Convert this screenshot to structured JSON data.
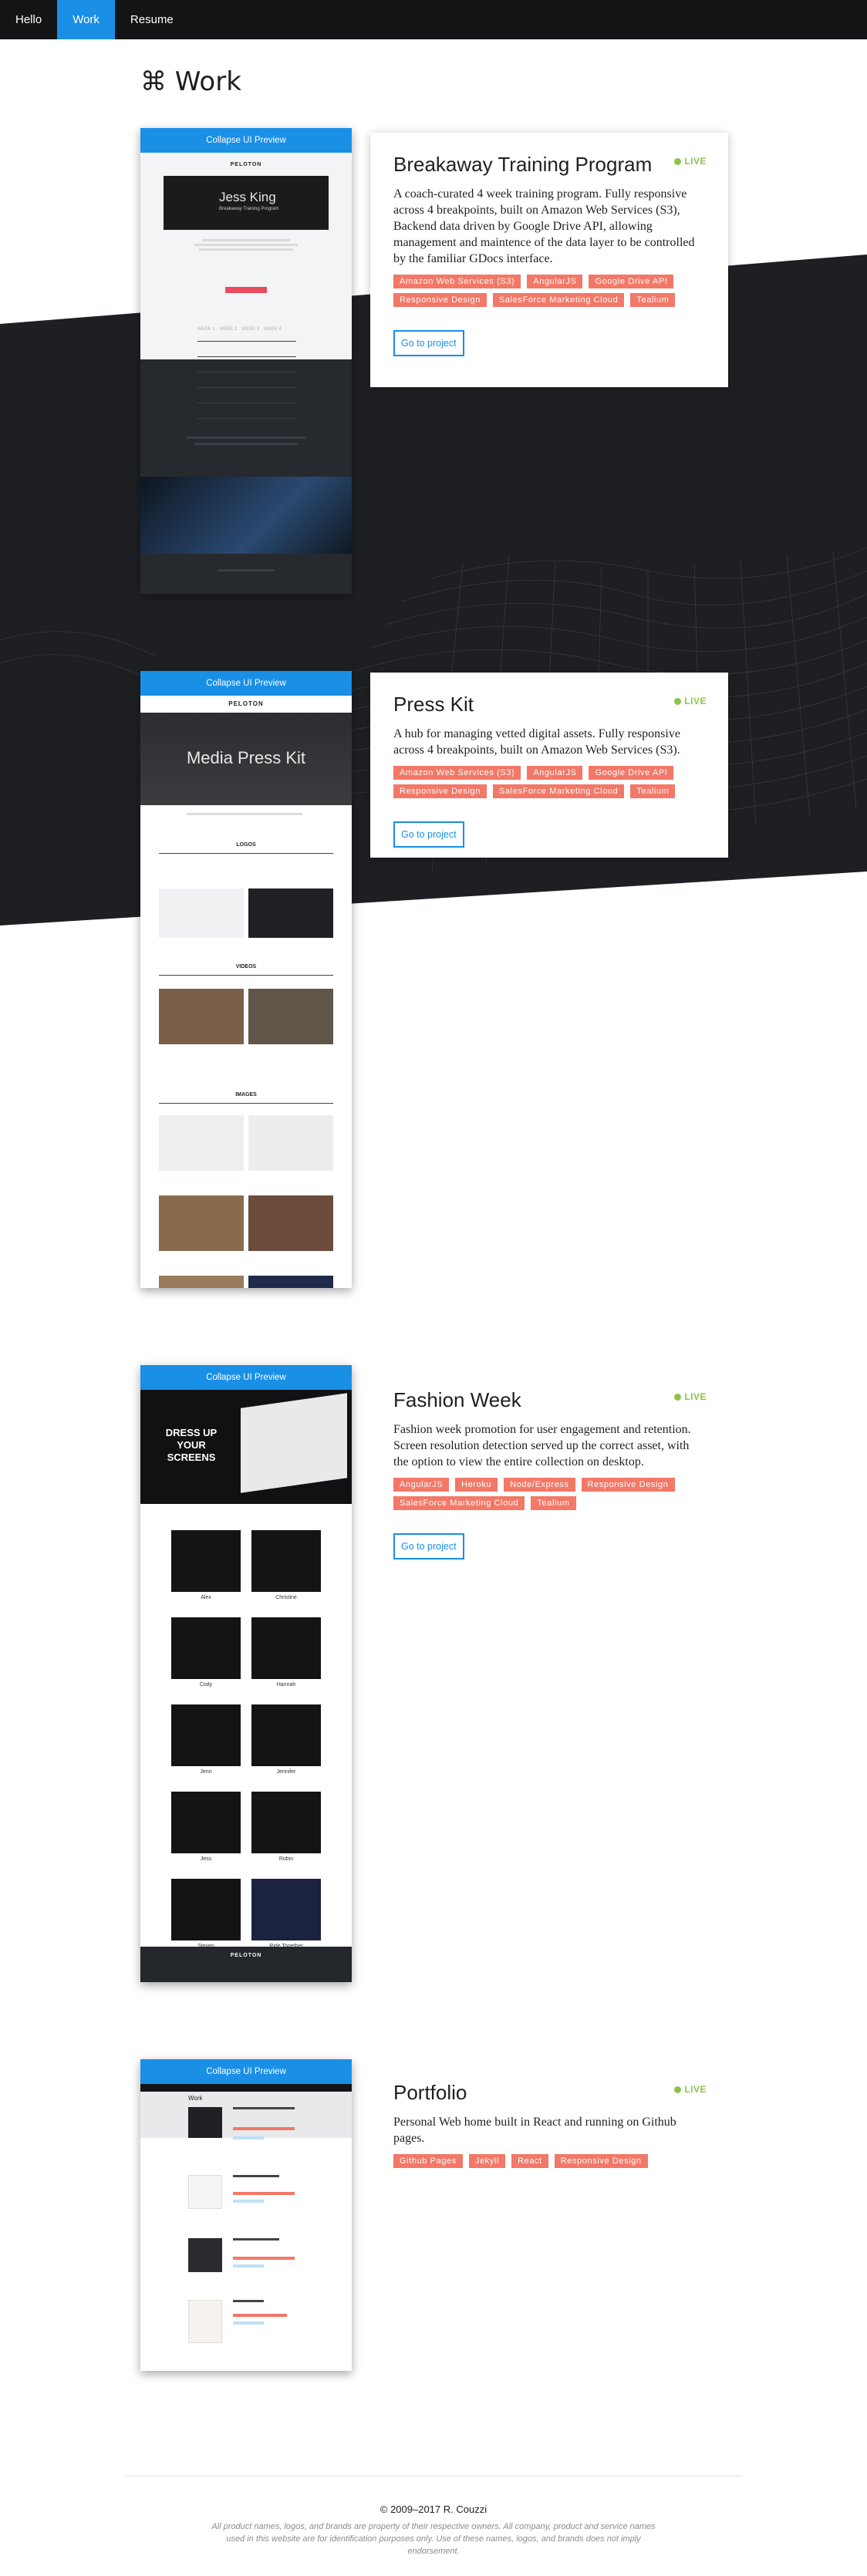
{
  "nav": {
    "items": [
      "Hello",
      "Work",
      "Resume"
    ]
  },
  "page": {
    "title": "⌘ Work"
  },
  "preview_bar_label": "Collapse UI Preview",
  "live_label": "LIVE",
  "go_label": "Go to project",
  "projects": [
    {
      "title": "Breakaway Training Program",
      "description": "A coach-curated 4 week training program. Fully responsive across 4 breakpoints, built on Amazon Web Services (S3), Backend data driven by Google Drive API, allowing management and maintence of the data layer to be controlled by the familiar GDocs interface.",
      "tags": [
        "Amazon Web Services (S3)",
        "AngularJS",
        "Google Drive API",
        "Responsive Design",
        "SalesForce Marketing Cloud",
        "Tealium"
      ],
      "preview": {
        "brand": "PELOTON",
        "hero_name": "Jess King",
        "hero_sub": "Breakaway Training Program",
        "weeks": [
          "WEEK 1",
          "WEEK 2",
          "WEEK 3",
          "WEEK 4"
        ]
      }
    },
    {
      "title": "Press Kit",
      "description": "A hub for managing vetted digital assets. Fully responsive across 4 breakpoints, built on Amazon Web Services (S3).",
      "tags": [
        "Amazon Web Services (S3)",
        "AngularJS",
        "Google Drive API",
        "Responsive Design",
        "SalesForce Marketing Cloud",
        "Tealium"
      ],
      "preview": {
        "brand": "PELOTON",
        "hero": "Media Press Kit",
        "sections": [
          "LOGOS",
          "VIDEOS",
          "IMAGES"
        ]
      }
    },
    {
      "title": "Fashion Week",
      "description": "Fashion week promotion for user engagement and retention. Screen resolution detection served up the correct asset, with the option to view the entire collection on desktop.",
      "tags": [
        "AngularJS",
        "Heroku",
        "Node/Express",
        "Responsive Design",
        "SalesForce Marketing Cloud",
        "Tealium"
      ],
      "preview": {
        "hero": "DRESS UP YOUR SCREENS",
        "brand": "PELOTON",
        "names": [
          "Alex",
          "Christine",
          "Cody",
          "Hannah",
          "Jenn",
          "Jennifer",
          "Jess",
          "Robin",
          "Steven",
          "Ride Together"
        ]
      }
    },
    {
      "title": "Portfolio",
      "description": "Personal Web home built in React and running on Github pages.",
      "tags": [
        "Github Pages",
        "Jekyll",
        "React",
        "Responsive Design"
      ],
      "preview": {
        "heading": "Work"
      }
    }
  ],
  "footer": {
    "copyright": "© 2009–2017 R. Couzzi",
    "legal": "All product names, logos, and brands are property of their respective owners. All company, product and service names used in this website are for identification purposes only. Use of these names, logos, and brands does not imply endorsement."
  },
  "colors": {
    "accent": "#1a8fe6",
    "tag": "#f27867",
    "live": "#8bc34a",
    "dark": "#1d1f23"
  }
}
